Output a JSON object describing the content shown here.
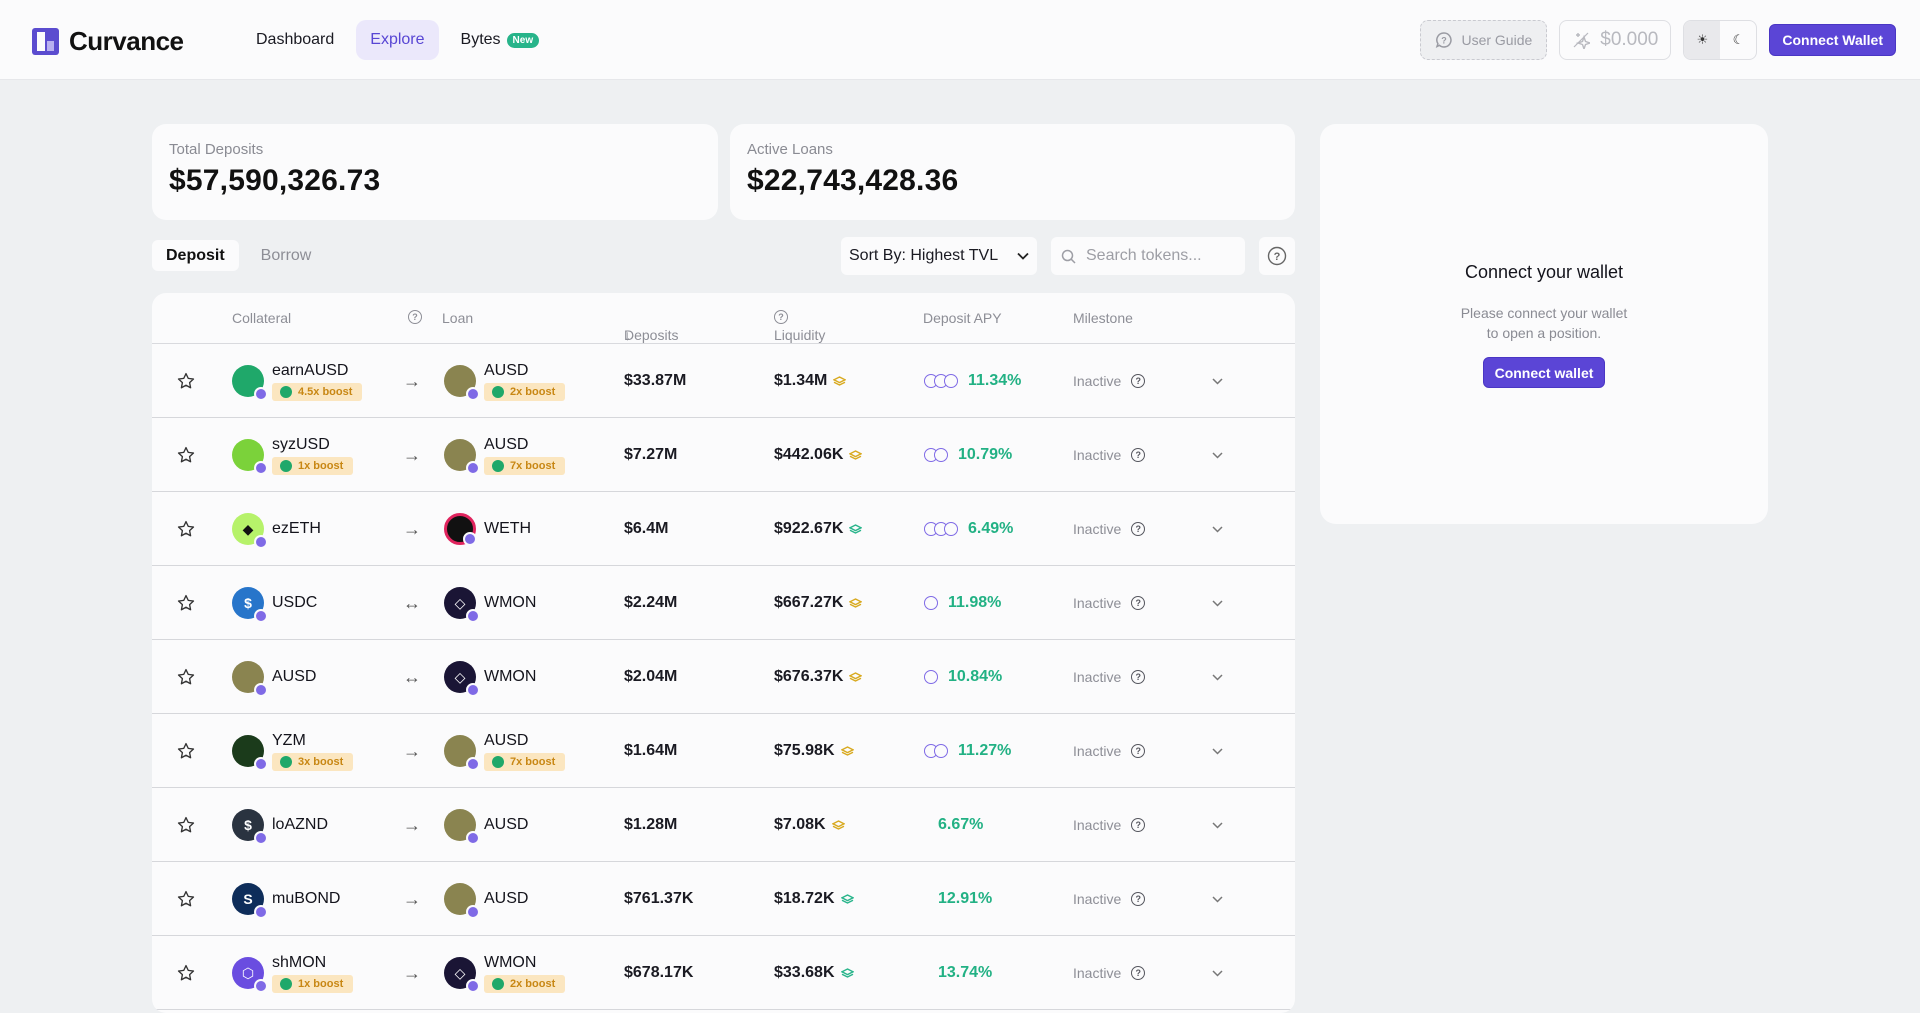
{
  "app": {
    "name": "Curvance"
  },
  "nav": [
    {
      "label": "Dashboard",
      "active": false
    },
    {
      "label": "Explore",
      "active": true
    },
    {
      "label": "Bytes",
      "active": false,
      "badge": "New"
    }
  ],
  "header": {
    "user_guide": "User Guide",
    "bytes_balance": "$0.000",
    "connect_wallet": "Connect Wallet"
  },
  "stats": {
    "total_deposits": {
      "label": "Total Deposits",
      "value": "$57,590,326.73"
    },
    "active_loans": {
      "label": "Active Loans",
      "value": "$22,743,428.36"
    }
  },
  "tabs": {
    "deposit": "Deposit",
    "borrow": "Borrow"
  },
  "sort": {
    "label": "Sort By: Highest TVL"
  },
  "search": {
    "placeholder": "Search tokens..."
  },
  "table": {
    "headers": {
      "collateral": "Collateral",
      "loan": "Loan",
      "deposits": "Deposits",
      "liquidity": "Liquidity",
      "deposit_apy": "Deposit APY",
      "milestone": "Milestone"
    },
    "rows": [
      {
        "collateral": "earnAUSD",
        "collateral_boost": "4.5x boost",
        "arrow": "→",
        "loan": "AUSD",
        "loan_boost": "2x boost",
        "deposits": "$33.87M",
        "liquidity": "$1.34M",
        "apy": "11.34%",
        "milestone": "Inactive"
      },
      {
        "collateral": "syzUSD",
        "collateral_boost": "1x boost",
        "arrow": "→",
        "loan": "AUSD",
        "loan_boost": "7x boost",
        "deposits": "$7.27M",
        "liquidity": "$442.06K",
        "apy": "10.79%",
        "milestone": "Inactive"
      },
      {
        "collateral": "ezETH",
        "collateral_boost": "",
        "arrow": "→",
        "loan": "WETH",
        "loan_boost": "",
        "deposits": "$6.4M",
        "liquidity": "$922.67K",
        "apy": "6.49%",
        "milestone": "Inactive"
      },
      {
        "collateral": "USDC",
        "collateral_boost": "",
        "arrow": "↔",
        "loan": "WMON",
        "loan_boost": "",
        "deposits": "$2.24M",
        "liquidity": "$667.27K",
        "apy": "11.98%",
        "milestone": "Inactive"
      },
      {
        "collateral": "AUSD",
        "collateral_boost": "",
        "arrow": "↔",
        "loan": "WMON",
        "loan_boost": "",
        "deposits": "$2.04M",
        "liquidity": "$676.37K",
        "apy": "10.84%",
        "milestone": "Inactive"
      },
      {
        "collateral": "YZM",
        "collateral_boost": "3x boost",
        "arrow": "→",
        "loan": "AUSD",
        "loan_boost": "7x boost",
        "deposits": "$1.64M",
        "liquidity": "$75.98K",
        "apy": "11.27%",
        "milestone": "Inactive"
      },
      {
        "collateral": "loAZND",
        "collateral_boost": "",
        "arrow": "→",
        "loan": "AUSD",
        "loan_boost": "",
        "deposits": "$1.28M",
        "liquidity": "$7.08K",
        "apy": "6.67%",
        "milestone": "Inactive"
      },
      {
        "collateral": "muBOND",
        "collateral_boost": "",
        "arrow": "→",
        "loan": "AUSD",
        "loan_boost": "",
        "deposits": "$761.37K",
        "liquidity": "$18.72K",
        "apy": "12.91%",
        "milestone": "Inactive"
      },
      {
        "collateral": "shMON",
        "collateral_boost": "1x boost",
        "arrow": "→",
        "loan": "WMON",
        "loan_boost": "2x boost",
        "deposits": "$678.17K",
        "liquidity": "$33.68K",
        "apy": "13.74%",
        "milestone": "Inactive"
      }
    ]
  },
  "wallet_panel": {
    "title": "Connect your wallet",
    "description": "Please connect your wallet to open a position.",
    "button": "Connect wallet"
  },
  "colors": {
    "accent": "#5b45d6",
    "positive": "#22b184",
    "boost_bg": "#fbe6c0",
    "boost_text": "#c88714"
  }
}
